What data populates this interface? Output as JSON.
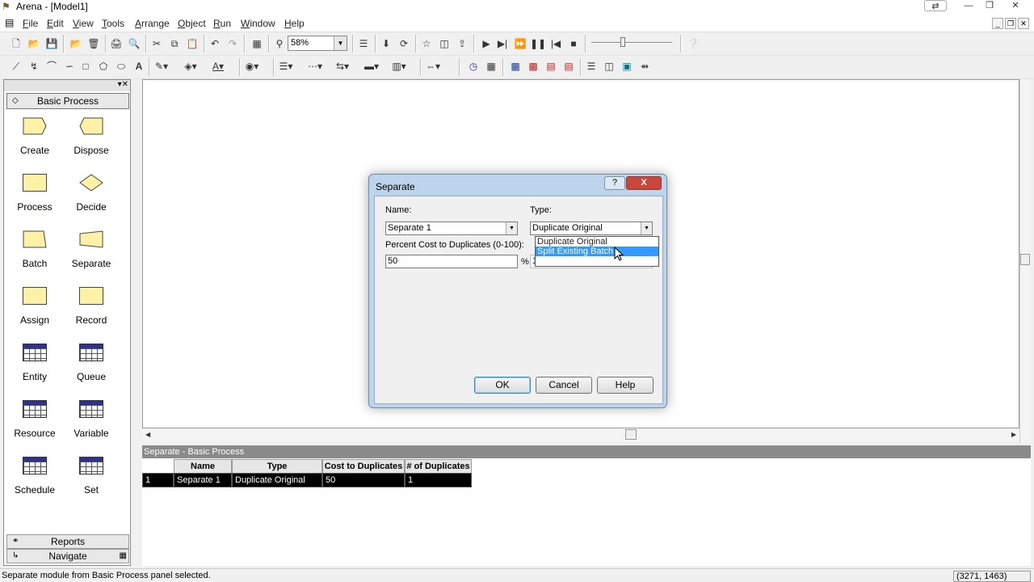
{
  "window": {
    "title": "Arena - [Model1]"
  },
  "menu": [
    "File",
    "Edit",
    "View",
    "Tools",
    "Arrange",
    "Object",
    "Run",
    "Window",
    "Help"
  ],
  "toolbar": {
    "zoom": "58%"
  },
  "panel": {
    "title": "Basic Process",
    "modules": [
      "Create",
      "Dispose",
      "Process",
      "Decide",
      "Batch",
      "Separate",
      "Assign",
      "Record",
      "Entity",
      "Queue",
      "Resource",
      "Variable",
      "Schedule",
      "Set"
    ],
    "reports": "Reports",
    "navigate": "Navigate"
  },
  "spreadsheet": {
    "title": "Separate - Basic Process",
    "columns": [
      "Name",
      "Type",
      "Cost to Duplicates",
      "# of Duplicates"
    ],
    "rows": [
      {
        "index": "1",
        "name": "Separate 1",
        "type": "Duplicate Original",
        "cost": "50",
        "dups": "1"
      }
    ]
  },
  "status": {
    "text": "Separate module from Basic Process panel selected.",
    "coords": "(3271, 1463)"
  },
  "dialog": {
    "title": "Separate",
    "help_glyph": "?",
    "close_glyph": "X",
    "name_label": "Name:",
    "name_value": "Separate 1",
    "type_label": "Type:",
    "type_value": "Duplicate Original",
    "type_options": [
      "Duplicate Original",
      "Split Existing Batch"
    ],
    "type_selected_index": 1,
    "cost_label": "Percent Cost to Duplicates (0-100):",
    "cost_value": "50",
    "cost_unit": "%",
    "dups_value": "1",
    "ok": "OK",
    "cancel": "Cancel",
    "help": "Help"
  }
}
